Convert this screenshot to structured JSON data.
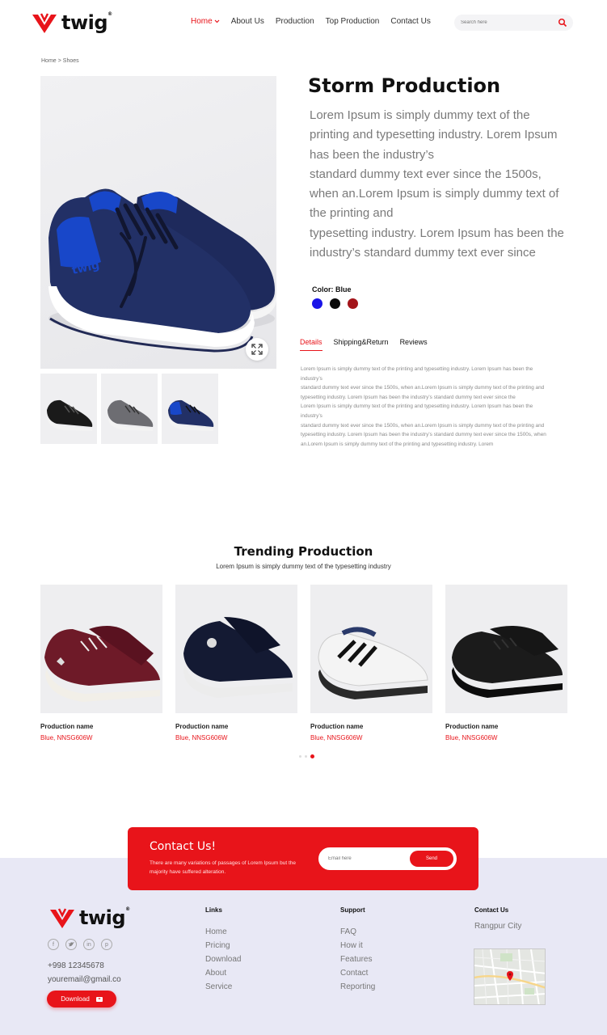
{
  "brand": {
    "name": "twig",
    "trademark": "®",
    "color": "#e8141a"
  },
  "nav": {
    "items": [
      {
        "label": "Home",
        "active": true
      },
      {
        "label": "About Us"
      },
      {
        "label": "Production"
      },
      {
        "label": "Top Production"
      },
      {
        "label": "Contact Us"
      }
    ]
  },
  "search": {
    "placeholder": "Search here",
    "icon": "search-icon"
  },
  "breadcrumb": {
    "home": "Home",
    "separator": ">",
    "current": "Shoes"
  },
  "product": {
    "title": "Storm Production",
    "description": [
      "Lorem Ipsum is simply dummy text of the printing and typesetting industry. Lorem Ipsum has been the industry’s",
      "standard dummy text ever since the 1500s, when an.Lorem Ipsum is simply dummy text of the printing and",
      "typesetting industry. Lorem Ipsum has been the industry’s standard dummy text ever since"
    ],
    "color_label": "Color: Blue",
    "colors": [
      "#1a14e8",
      "#0a0a0a",
      "#a3141a"
    ]
  },
  "tabs": [
    {
      "label": "Details",
      "active": true
    },
    {
      "label": "Shipping&Return"
    },
    {
      "label": "Reviews"
    }
  ],
  "details": [
    "Lorem Ipsum is simply dummy text of the printing and typesetting industry. Lorem Ipsum has been the industry’s",
    "standard dummy text ever since the 1500s, when an.Lorem Ipsum is simply dummy text of the printing and",
    "typesetting industry. Lorem Ipsum has been the industry’s standard dummy text ever since the",
    "Lorem Ipsum is simply dummy text of the printing and typesetting industry. Lorem Ipsum has been the industry’s",
    "standard dummy text ever since the 1500s, when an.Lorem Ipsum is simply dummy text of the printing and",
    "typesetting industry. Lorem Ipsum has been the industry’s standard dummy text ever since the 1500s, when an.Lorem Ipsum is simply dummy text of the printing and typesetting industry. Lorem"
  ],
  "trending": {
    "title": "Trending Production",
    "subtitle": "Lorem Ipsum is simply dummy text of the  typesetting industry",
    "items": [
      {
        "name": "Production name",
        "sku": "Blue, NNSG606W"
      },
      {
        "name": "Production name",
        "sku": "Blue, NNSG606W"
      },
      {
        "name": "Production name",
        "sku": "Blue, NNSG606W"
      },
      {
        "name": "Production name",
        "sku": "Blue, NNSG606W"
      }
    ],
    "pagination": {
      "pages": 3,
      "active": 3
    }
  },
  "contact": {
    "title": "Contact Us!",
    "text": "There are many variations of passages of Lorem Ipsum but the majority have suffered alteration.",
    "email_placeholder": "Email here",
    "send_label": "Send"
  },
  "footer": {
    "social_icons": [
      "facebook-icon",
      "twitter-icon",
      "linkedin-icon",
      "pinterest-icon"
    ],
    "phone": "+998 12345678",
    "email": "youremail@gmail.co",
    "download_label": "Download",
    "links": {
      "heading": "Links",
      "items": [
        "Home",
        "Pricing",
        "Download",
        "About",
        "Service"
      ]
    },
    "support": {
      "heading": "Support",
      "items": [
        "FAQ",
        "How it",
        "Features",
        "Contact",
        "Reporting"
      ]
    },
    "contact": {
      "heading": "Contact Us",
      "city": "Rangpur City"
    },
    "background": "#e8e8f5"
  }
}
